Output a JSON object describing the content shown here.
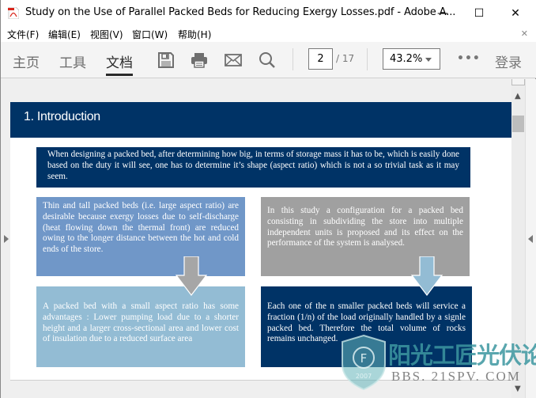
{
  "window": {
    "title": "Study on the Use of Parallel Packed Beds for Reducing Exergy Losses.pdf - Adobe A...",
    "controls": {
      "minimize": "—",
      "maximize": "☐",
      "close": "✕"
    }
  },
  "menubar": {
    "items": [
      {
        "label": "文件(F)"
      },
      {
        "label": "编辑(E)"
      },
      {
        "label": "视图(V)"
      },
      {
        "label": "窗口(W)"
      },
      {
        "label": "帮助(H)"
      }
    ],
    "close_doc": "✕"
  },
  "toolbar": {
    "tabs": [
      {
        "label": "主页",
        "active": false
      },
      {
        "label": "工具",
        "active": false
      },
      {
        "label": "文档",
        "active": true
      }
    ],
    "icons": [
      "save-icon",
      "print-icon",
      "email-icon",
      "search-icon"
    ],
    "page_current": "2",
    "page_total": "/ 17",
    "zoom_level": "43.2%",
    "more": "•••",
    "login": "登录"
  },
  "document": {
    "section_title": "1. Introduction",
    "intro_text": "When designing a packed bed, after  determining  how big, in terms of storage mass it has to be, which is easily done based on the duty it will see, one has to determine it’s shape (aspect ratio)  which is not a so trivial task as it may seem.",
    "box_tall": "Thin and tall packed beds  (i.e. large aspect ratio) are desirable  because exergy losses due to self-discharge (heat flowing down the thermal front) are reduced owing to the longer distance between the hot and cold ends of the store.",
    "box_study": "In this study a configuration for a packed bed consisting in subdividing the store into multiple independent units is proposed and its effect on the performance of the system is analysed.",
    "box_small": "A packed bed with a small aspect ratio has some advantages : Lower pumping load due to a shorter height and a larger cross-sectional area and lower cost of insulation due to a reduced surface area",
    "box_parallel": "Each one of the n smaller packed beds will service a fraction (1/n) of the load originally handled by a signle packed bed. Therefore the total volume of rocks remains unchanged."
  },
  "watermark": {
    "name": "阳光工匠光伏论坛",
    "url": "BBS. 21SPV. COM",
    "year": "2007"
  },
  "colors": {
    "navy": "#003366",
    "steel_blue": "#7097c8",
    "gray": "#a0a0a0",
    "light_blue": "#93bcd4"
  }
}
